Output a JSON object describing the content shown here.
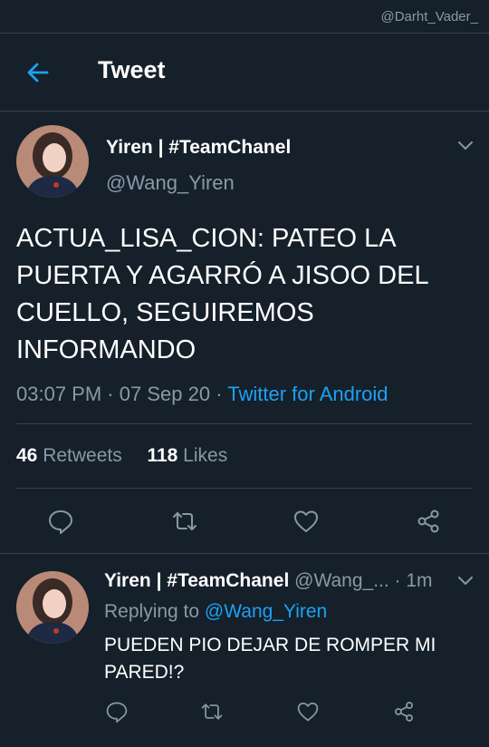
{
  "watermark": "@Darht_Vader_",
  "header": {
    "title": "Tweet"
  },
  "main_tweet": {
    "name": "Yiren | #TeamChanel",
    "handle": "@Wang_Yiren",
    "text": "ACTUA_LISA_CION: PATEO LA PUERTA Y AGARRÓ A JISOO DEL CUELLO, SEGUIREMOS INFORMANDO",
    "time": "03:07 PM",
    "date": "07 Sep 20",
    "separator": "·",
    "source": "Twitter for Android",
    "retweets_count": "46",
    "retweets_label": "Retweets",
    "likes_count": "118",
    "likes_label": "Likes"
  },
  "reply_tweet": {
    "name": "Yiren | #TeamChanel",
    "handle_time": "@Wang_... · 1m",
    "replying_prefix": "Replying to",
    "replying_handle": "@Wang_Yiren",
    "text": "PUEDEN PIO DEJAR DE ROMPER MI PARED!?"
  },
  "icons": [
    "back-arrow-icon",
    "chevron-down-icon",
    "reply-icon",
    "retweet-icon",
    "like-icon",
    "share-icon"
  ],
  "colors": {
    "background": "#15202b",
    "accent": "#1da1f2",
    "secondary_text": "#8899a6",
    "divider": "#38444d"
  }
}
